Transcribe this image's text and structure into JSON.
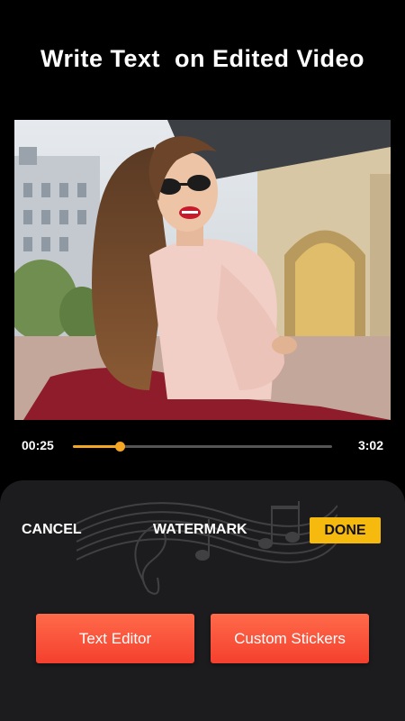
{
  "headline": "Write Text  on Edited Video",
  "player": {
    "current_time": "00:25",
    "total_time": "3:02",
    "progress": 0.18
  },
  "editor": {
    "cancel_label": "CANCEL",
    "title": "WATERMARK",
    "done_label": "DONE",
    "text_editor_label": "Text Editor",
    "custom_stickers_label": "Custom Stickers"
  },
  "colors": {
    "accent_progress": "#f5a623",
    "done_button": "#f6b90e",
    "action_button_gradient": [
      "#ff6a4a",
      "#f4402e"
    ],
    "panel_background": "#1c1c1e"
  },
  "icons": [
    "music-notes-decoration"
  ]
}
